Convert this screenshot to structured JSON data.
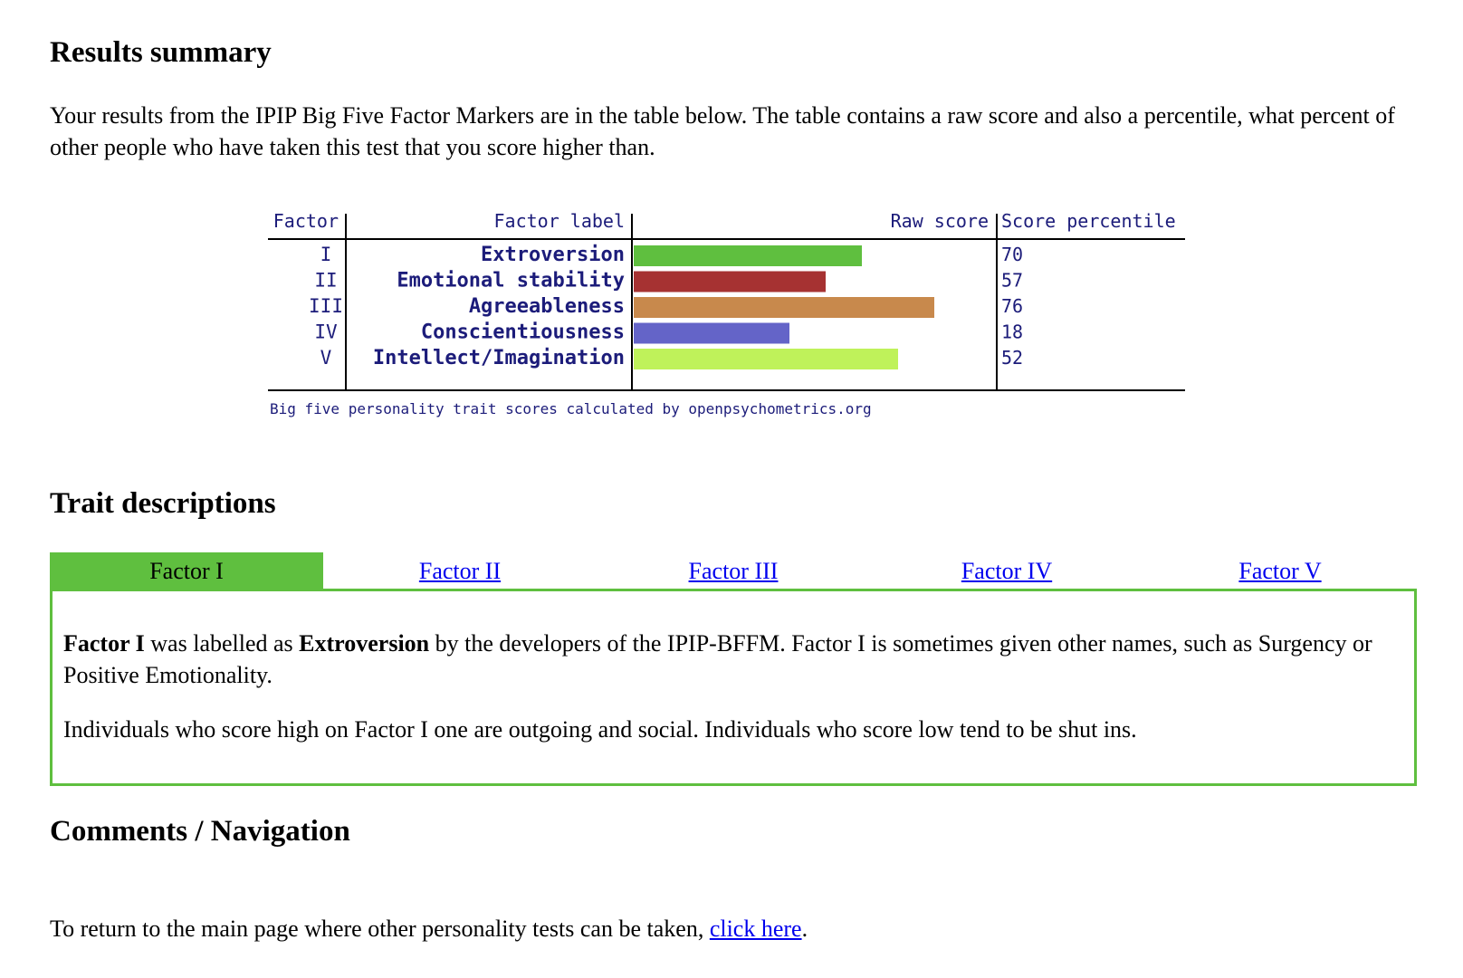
{
  "sections": {
    "results_title": "Results summary",
    "intro_text": "Your results from the IPIP Big Five Factor Markers are in the table below. The table contains a raw score and also a percentile, what percent of other people who have taken this test that you score higher than.",
    "traits_title": "Trait descriptions",
    "comments_title": "Comments / Navigation"
  },
  "chart_data": {
    "type": "bar",
    "headers": {
      "factor": "Factor",
      "label": "Factor label",
      "raw": "Raw score",
      "percentile": "Score percentile"
    },
    "factors": [
      "I",
      "II",
      "III",
      "IV",
      "V"
    ],
    "categories": [
      "Extroversion",
      "Emotional stability",
      "Agreeableness",
      "Conscientiousness",
      "Intellect/Imagination"
    ],
    "percentiles": [
      70,
      57,
      76,
      18,
      52
    ],
    "raw_scores": [
      63,
      53,
      83,
      43,
      73
    ],
    "raw_score_max": 100,
    "colors": [
      "#5fbf3f",
      "#a63232",
      "#c8894c",
      "#6464c8",
      "#bff25a"
    ],
    "label_color": "#1c1c7a",
    "caption": "Big five personality trait scores calculated by openpsychometrics.org"
  },
  "tabs": {
    "items": [
      "Factor I",
      "Factor II",
      "Factor III",
      "Factor IV",
      "Factor V"
    ],
    "active_index": 0,
    "accent": "#5fbf3f"
  },
  "panel": {
    "factor": "Factor I",
    "mid1": " was labelled as ",
    "trait": "Extroversion",
    "mid2": " by the developers of the IPIP-BFFM. Factor I is sometimes given other names, such as Surgency or Positive Emotionality.",
    "paragraph2": "Individuals who score high on Factor I one are outgoing and social. Individuals who score low tend to be shut ins."
  },
  "footer": {
    "prefix": "To return to the main page where other personality tests can be taken, ",
    "link": "click here",
    "suffix": "."
  }
}
